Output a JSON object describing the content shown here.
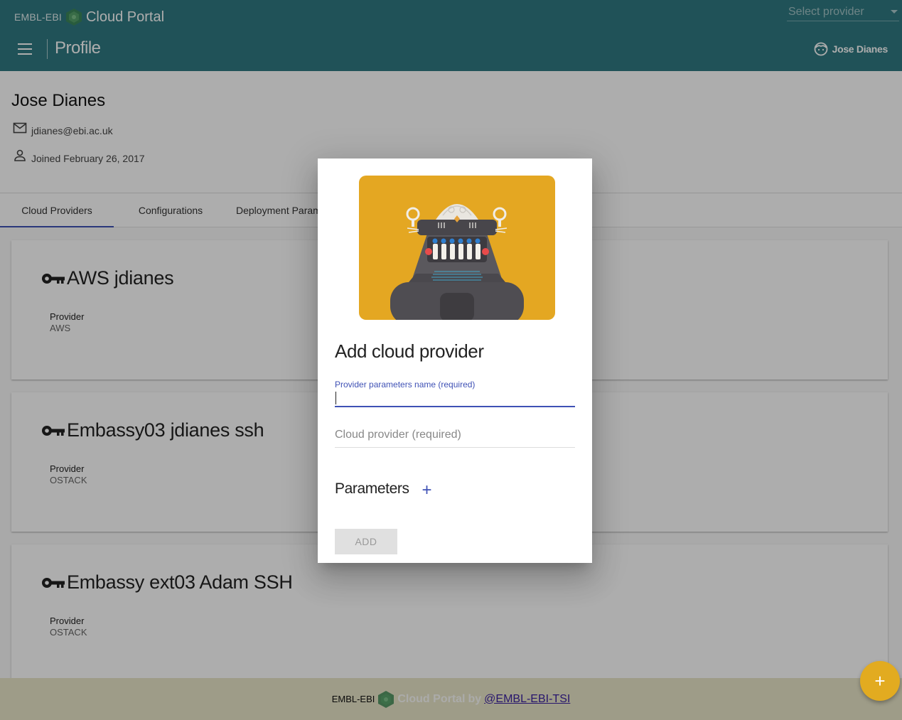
{
  "header": {
    "brand_prefix": "EMBL-EBI",
    "brand_name": "Cloud Portal",
    "provider_select_placeholder": "Select provider",
    "page_title": "Profile",
    "user_name": "Jose Dianes"
  },
  "profile": {
    "name": "Jose Dianes",
    "email": "jdianes@ebi.ac.uk",
    "joined": "Joined February 26, 2017"
  },
  "tabs": [
    {
      "label": "Cloud Providers",
      "active": true
    },
    {
      "label": "Configurations",
      "active": false
    },
    {
      "label": "Deployment Parameters",
      "active": false
    }
  ],
  "cards": [
    {
      "title": "AWS jdianes",
      "provider_label": "Provider",
      "provider_value": "AWS"
    },
    {
      "title": "Embassy03 jdianes ssh",
      "provider_label": "Provider",
      "provider_value": "OSTACK"
    },
    {
      "title": "Embassy ext03 Adam SSH",
      "provider_label": "Provider",
      "provider_value": "OSTACK"
    }
  ],
  "dialog": {
    "title": "Add cloud provider",
    "name_field_label": "Provider parameters name (required)",
    "provider_field_placeholder": "Cloud provider (required)",
    "parameters_label": "Parameters",
    "parameters_add": "+",
    "add_button": "ADD"
  },
  "fab": {
    "label": "+"
  },
  "footer": {
    "brand_prefix": "EMBL-EBI",
    "brand_name": "Cloud Portal",
    "by": "by",
    "link": "@EMBL-EBI-TSI"
  },
  "colors": {
    "header": "#307a82",
    "accent": "#3f51b5",
    "fab": "#e2ab20",
    "robot_bg": "#e4a722"
  }
}
